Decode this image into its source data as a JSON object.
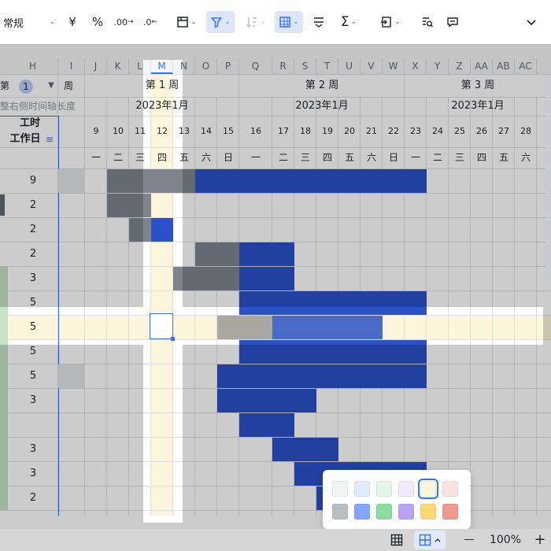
{
  "toolbar": {
    "format": "常规",
    "currency_glyph": "¥",
    "percent_glyph": "%",
    "decimal_inc_glyph": ".00",
    "decimal_dec_glyph": ".0",
    "sum_glyph": "Σ",
    "collapse_glyph": "⌄"
  },
  "columns": [
    "H",
    "I",
    "J",
    "K",
    "L",
    "M",
    "N",
    "O",
    "P",
    "Q",
    "R",
    "S",
    "T",
    "U",
    "V",
    "W",
    "X",
    "Y",
    "Z",
    "AA",
    "AB",
    "AC"
  ],
  "header": {
    "prefix": "第",
    "week_index": "1",
    "suffix": "周",
    "hint": "整右侧时间轴长度",
    "worktime_label": "工时",
    "workday_label": "工作日"
  },
  "weeks": [
    {
      "label": "第 1 周",
      "month": "2023年1月"
    },
    {
      "label": "第 2 周",
      "month": "2023年1月"
    },
    {
      "label": "第 3 周",
      "month": "2023年1月"
    }
  ],
  "days": [
    "9",
    "10",
    "11",
    "12",
    "13",
    "14",
    "15",
    "16",
    "17",
    "18",
    "19",
    "20",
    "21",
    "22",
    "23",
    "24",
    "25",
    "26",
    "27",
    "28"
  ],
  "weekdays": [
    "一",
    "二",
    "三",
    "四",
    "五",
    "六",
    "日",
    "一",
    "二",
    "三",
    "四",
    "五",
    "六",
    "日",
    "一",
    "二",
    "三",
    "四",
    "五",
    "六"
  ],
  "workdays": [
    "9",
    "2",
    "2",
    "2",
    "3",
    "5",
    "5",
    "5",
    "5",
    "3",
    "",
    "3",
    "3",
    "2"
  ],
  "zoom": "100%",
  "zoom_minus": "—",
  "zoom_plus": "+",
  "palette": {
    "light": [
      "#f2f3f5",
      "#e1eaff",
      "#e4f5e9",
      "#efeafd",
      "#fdf6dc",
      "#fde2e2"
    ],
    "dark": [
      "#bbbfc4",
      "#82a7fc",
      "#8cdba3",
      "#b9a2f6",
      "#fad873",
      "#f19891"
    ],
    "selected_index": 4
  },
  "colors": {
    "bar_blue": "#2a51c8",
    "bar_gray": "#7e858e",
    "highlight": "#fdf6dc",
    "accent": "#3370ff"
  }
}
